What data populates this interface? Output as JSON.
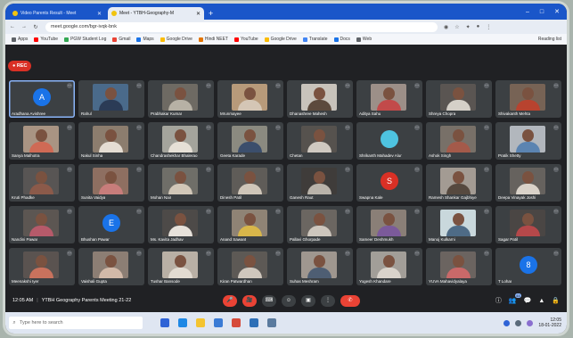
{
  "browser": {
    "tabs": [
      {
        "label": "Video Parents Result - Meet",
        "active": false
      },
      {
        "label": "Meet - YTBH-Geography-M",
        "active": true
      },
      {
        "label": "",
        "active": false
      }
    ],
    "url": "meet.google.com/bgr-ivqk-bnk",
    "bookmarks": [
      "Apps",
      "YouTube",
      "PGW Student Log",
      "Gmail",
      "Maps",
      "Google Drive",
      "Hindi NEET",
      "YouTube",
      "Google Drive",
      "Translate",
      "Docs",
      "Web"
    ],
    "bookmarks_right": "Reading list",
    "window_controls": [
      "–",
      "□",
      "✕"
    ]
  },
  "recording": {
    "label": "● REC"
  },
  "participants": [
    {
      "name": "Aradhana Avishree",
      "kind": "avatar",
      "letter": "A",
      "color": "#1a73e8",
      "pinned": true
    },
    {
      "name": "Rahul",
      "kind": "video",
      "bg": "#4a6a8a",
      "shirt": "#2b3b56"
    },
    {
      "name": "Prabhakar Kumar",
      "kind": "video",
      "bg": "#6e6a63",
      "shirt": "#b7b1a5"
    },
    {
      "name": "Mrunmayee",
      "kind": "video",
      "bg": "#b79a7a",
      "shirt": "#d4c6b5"
    },
    {
      "name": "Dhanashree Mahesh",
      "kind": "video",
      "bg": "#c8c3bb",
      "shirt": "#5c4a3d"
    },
    {
      "name": "Aditya Sahu",
      "kind": "video",
      "bg": "#9c8f88",
      "shirt": "#c24a4a"
    },
    {
      "name": "Shreya Chopra",
      "kind": "video",
      "bg": "#5a5552",
      "shirt": "#d5d0c8"
    },
    {
      "name": "Shivakanth Mehta",
      "kind": "video",
      "bg": "#776355",
      "shirt": "#b8432f"
    },
    {
      "name": "Sanya Malhotra",
      "kind": "video",
      "bg": "#a99483",
      "shirt": "#cf6a55"
    },
    {
      "name": "Nakul Sinha",
      "kind": "video",
      "bg": "#8c7d6e",
      "shirt": "#e5ddd3"
    },
    {
      "name": "Chandrashekhar Bhalerao",
      "kind": "video",
      "bg": "#a4a49c",
      "shirt": "#e6e0d6"
    },
    {
      "name": "Geeta Karade",
      "kind": "video",
      "bg": "#8b8a80",
      "shirt": "#3b4e6c"
    },
    {
      "name": "Chetan",
      "kind": "video",
      "bg": "#56524e",
      "shirt": "#cfc9c1"
    },
    {
      "name": "Shrikanth Mahadev Alur",
      "kind": "avatar",
      "letter": "",
      "color": "#4ec3e0",
      "pinned": false
    },
    {
      "name": "Ashok Singh",
      "kind": "video",
      "bg": "#787068",
      "shirt": "#a45a4a"
    },
    {
      "name": "Pratik Shetty",
      "kind": "video",
      "bg": "#b2b7bd",
      "shirt": "#5b84b1"
    },
    {
      "name": "Kruti Phadke",
      "kind": "video",
      "bg": "#585554",
      "shirt": "#8b5a4a"
    },
    {
      "name": "Sunita Vaidya",
      "kind": "video",
      "bg": "#8e6f61",
      "shirt": "#c87d7b"
    },
    {
      "name": "Mohan Nair",
      "kind": "video",
      "bg": "#6f6e68",
      "shirt": "#d1c7b8"
    },
    {
      "name": "Dinesh Patil",
      "kind": "video",
      "bg": "#5f5c58",
      "shirt": "#cfc6b9"
    },
    {
      "name": "Ganesh Raut",
      "kind": "video",
      "bg": "#3f3c3a",
      "shirt": "#b9b3aa"
    },
    {
      "name": "Swapna Kale",
      "kind": "avatar",
      "letter": "S",
      "color": "#d93025",
      "pinned": false
    },
    {
      "name": "Ramesh Shankar Gajbhiye",
      "kind": "video",
      "bg": "#a39b93",
      "shirt": "#56493f"
    },
    {
      "name": "Deepa Vinayak Joshi",
      "kind": "video",
      "bg": "#66625e",
      "shirt": "#d9d2c9"
    },
    {
      "name": "Nandini Pawar",
      "kind": "video",
      "bg": "#5c5652",
      "shirt": "#b65a6a"
    },
    {
      "name": "Bhushan Pawar",
      "kind": "avatar",
      "letter": "E",
      "color": "#1a73e8",
      "pinned": false
    },
    {
      "name": "Ms. Kavita Jadhav",
      "kind": "video",
      "bg": "#4d4a48",
      "shirt": "#e6e1da"
    },
    {
      "name": "Anand Sawant",
      "kind": "video",
      "bg": "#8f8375",
      "shirt": "#d8b64a"
    },
    {
      "name": "Pallavi Ghorpade",
      "kind": "video",
      "bg": "#6b6661",
      "shirt": "#cdc6bd"
    },
    {
      "name": "Sameer Deshmukh",
      "kind": "video",
      "bg": "#8a7f77",
      "shirt": "#7b5a9a"
    },
    {
      "name": "Manoj Kulkarni",
      "kind": "video",
      "bg": "#c9d8dc",
      "shirt": "#4e6b86"
    },
    {
      "name": "Sagar Patil",
      "kind": "video",
      "bg": "#4a4644",
      "shirt": "#b5484a"
    },
    {
      "name": "Meenakshi Iyer",
      "kind": "video",
      "bg": "#5a5350",
      "shirt": "#c8725d"
    },
    {
      "name": "Vaishali Gupta",
      "kind": "video",
      "bg": "#8c7e74",
      "shirt": "#d2b9a8"
    },
    {
      "name": "Tushar Bansode",
      "kind": "video",
      "bg": "#b9b0a5",
      "shirt": "#e2dbd1"
    },
    {
      "name": "Kiran Patwardhan",
      "kind": "video",
      "bg": "#5d5955",
      "shirt": "#cfc7bd"
    },
    {
      "name": "Suhas Meshram",
      "kind": "video",
      "bg": "#9f978f",
      "shirt": "#4e5e73"
    },
    {
      "name": "Yogesh Khandare",
      "kind": "video",
      "bg": "#a29e98",
      "shirt": "#d9d3cb"
    },
    {
      "name": "YUVA Mahavidyalaya",
      "kind": "video",
      "bg": "#6b6460",
      "shirt": "#c96969"
    },
    {
      "name": "T Lohar",
      "kind": "avatar",
      "letter": "8",
      "color": "#1a73e8",
      "pinned": false
    }
  ],
  "controls": {
    "clock": "12:05 AM",
    "meeting_name": "YTBH Geography Parents Meeting 21-22",
    "buttons": [
      "🎤",
      "🎥",
      "⌨",
      "☺",
      "▣",
      "⋮",
      "✆"
    ],
    "right": [
      {
        "icon": "ⓘ",
        "badge": ""
      },
      {
        "icon": "👥",
        "badge": "44"
      },
      {
        "icon": "💬",
        "badge": ""
      },
      {
        "icon": "▲",
        "badge": ""
      },
      {
        "icon": "🔒",
        "badge": ""
      }
    ]
  },
  "taskbar": {
    "search_placeholder": "Type here to search",
    "time": "12:05",
    "date": "18-01-2022"
  },
  "colors": {
    "meet_bg": "#202124",
    "tile_bg": "#3c4043",
    "accent_blue": "#1a73e8",
    "end_call": "#ea4335"
  }
}
